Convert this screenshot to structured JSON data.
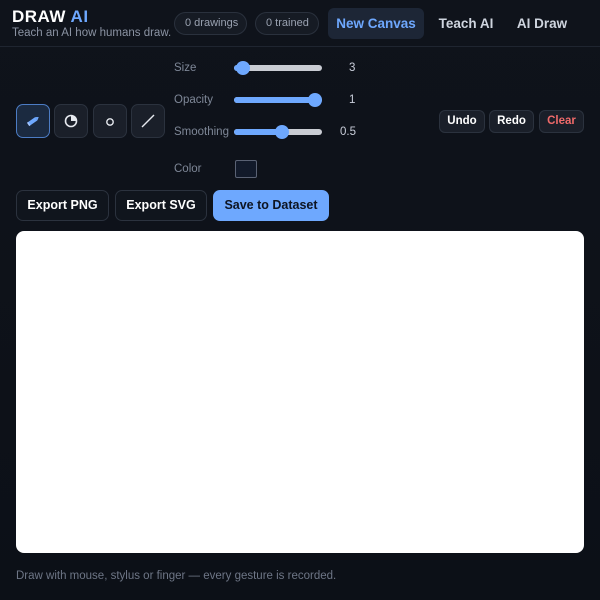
{
  "brand": {
    "title": "DRAW",
    "accent": "AI",
    "subtitle": "Teach an AI how humans draw."
  },
  "stats": {
    "drawings": "0 drawings",
    "trained": "0 trained"
  },
  "tabs": [
    {
      "label": "New Canvas",
      "active": true
    },
    {
      "label": "Teach AI",
      "active": false
    },
    {
      "label": "AI Draw",
      "active": false
    }
  ],
  "tools": [
    {
      "name": "pencil-icon",
      "active": true
    },
    {
      "name": "fill-icon",
      "active": false
    },
    {
      "name": "circle-icon",
      "active": false
    },
    {
      "name": "line-icon",
      "active": false
    }
  ],
  "controls": {
    "size": {
      "label": "Size",
      "value": "3",
      "fraction": 0.1
    },
    "opacity": {
      "label": "Opacity",
      "value": "1",
      "fraction": 1.0
    },
    "smoothing": {
      "label": "Smoothing",
      "value": "0.5",
      "fraction": 0.55
    },
    "color": {
      "label": "Color",
      "value": "#121a2a"
    }
  },
  "actions": {
    "undo": "Undo",
    "redo": "Redo",
    "clear": "Clear"
  },
  "export": {
    "png": "Export PNG",
    "svg": "Export SVG",
    "save": "Save to Dataset"
  },
  "footer": "Draw with mouse, stylus or finger — every gesture is recorded.",
  "colors": {
    "accent": "#6ea8fe",
    "danger": "#f06a6a",
    "background": "#0f131b",
    "canvas": "#ffffff"
  }
}
